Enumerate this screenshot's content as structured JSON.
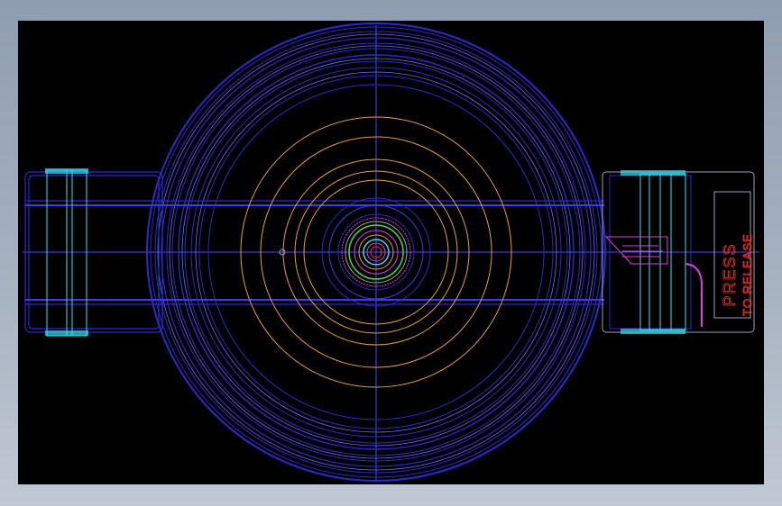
{
  "viewport": {
    "background": "#000000",
    "frame_background": "#98a6b7"
  },
  "drawing": {
    "subject": "cad-wireframe-top-view",
    "label_line1": "PRESS",
    "label_line2": "TO RELEASE",
    "colors": {
      "outline_blue": "#2a2ad0",
      "bright_blue": "#3a3aff",
      "light_blue": "#6f6fe8",
      "orange": "#e8a030",
      "cyan": "#30e0f0",
      "magenta": "#e040e0",
      "red": "#ff3030",
      "green": "#40e040",
      "gray": "#a0a0b8"
    }
  }
}
